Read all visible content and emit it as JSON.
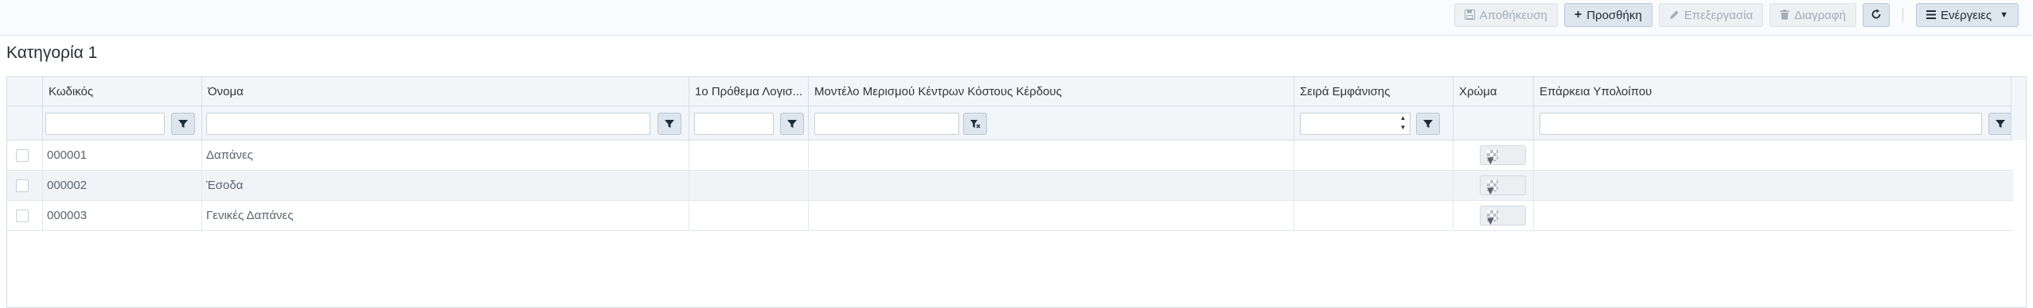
{
  "toolbar": {
    "save_label": "Αποθήκευση",
    "add_label": "Προσθήκη",
    "edit_label": "Επεξεργασία",
    "delete_label": "Διαγραφή",
    "actions_label": "Ενέργειες"
  },
  "page_title": "Κατηγορία 1",
  "grid": {
    "columns": [
      "Κωδικός",
      "Όνομα",
      "1ο Πρόθεμα Λογισ...",
      "Μοντέλο Μερισμού Κέντρων Κόστους Κέρδους",
      "Σειρά Εμφάνισης",
      "Χρώμα",
      "Επάρκεια Υπολοίπου"
    ],
    "rows": [
      {
        "code": "000001",
        "name": "Δαπάνες"
      },
      {
        "code": "000002",
        "name": "Έσοδα"
      },
      {
        "code": "000003",
        "name": "Γενικές Δαπάνες"
      }
    ]
  },
  "colors": {
    "accent": "#dde6ef",
    "border": "#d6dde4",
    "header_bg": "#f3f6f9"
  },
  "icons": [
    "save-icon",
    "plus-icon",
    "pencil-icon",
    "trash-icon",
    "refresh-icon",
    "menu-icon",
    "filter-icon",
    "filter-clear-icon"
  ]
}
